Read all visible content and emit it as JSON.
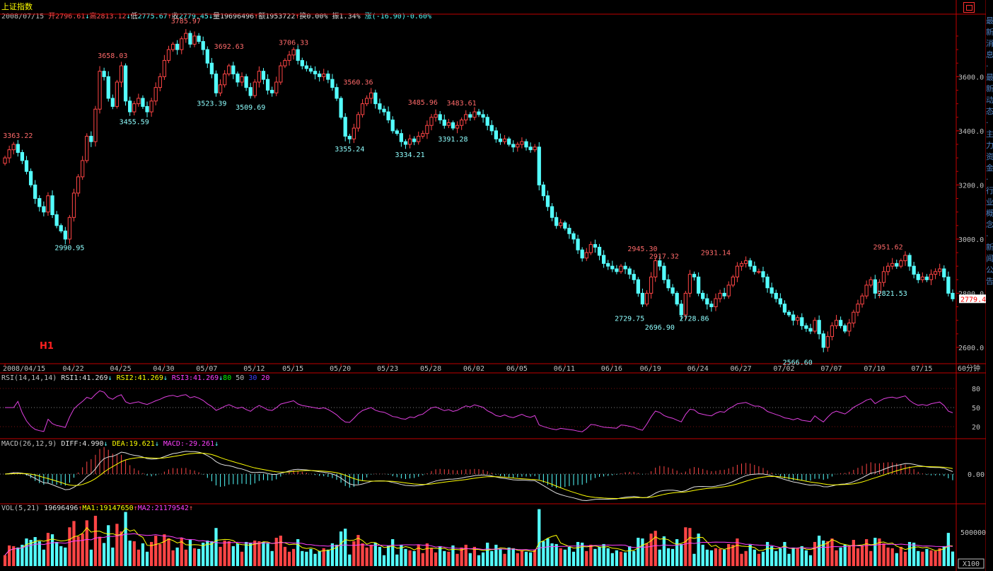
{
  "header": {
    "title": "上证指数",
    "date": "2008/07/15",
    "open_label": "开",
    "open": "2796.61",
    "open_arrow": "↓",
    "high_label": "高",
    "high": "2813.12",
    "high_arrow": "↓",
    "low_label": "低",
    "low": "2775.67",
    "low_arrow": "↑",
    "close_label": "收",
    "close": "2779.45",
    "close_arrow": "↓",
    "vol_label": "量",
    "vol": "19696496",
    "vol_arrow": "↑",
    "amt_label": "额",
    "amt": "1953722",
    "amt_arrow": "↑",
    "turn_label": "换",
    "turn": "0.00%",
    "amp_label": "振",
    "amp": "1.34%",
    "chg_label": "涨",
    "chg": "(-16.90)-0.60%"
  },
  "indicators": {
    "rsi": {
      "name": "RSI(14,14,14)",
      "rsi1": "RSI1:41.269",
      "rsi1_arrow": "↓",
      "rsi2": "RSI2:41.269",
      "rsi2_arrow": "↓",
      "rsi3": "RSI3:41.269",
      "rsi3_arrow": "↓",
      "l80": "80",
      "l50": "50",
      "l30": "30",
      "l20": "20"
    },
    "macd": {
      "name": "MACD(26,12,9)",
      "diff": "DIFF:4.990",
      "diff_arrow": "↓",
      "dea": "DEA:19.621",
      "dea_arrow": "↓",
      "macd": "MACD:-29.261",
      "macd_arrow": "↓"
    },
    "vol": {
      "name": "VOL(5,21)",
      "value": "19696496",
      "ma1": "MA1:19147650",
      "ma1_arrow": "↑",
      "ma2": "MA2:21179542",
      "ma2_arrow": "↑"
    }
  },
  "badge": "H1",
  "period_label": "60分钟",
  "x100_label": "X100",
  "current_price_tag": "2779.4",
  "side_text": "最新消息·最新动态·主力资金·行业概念·新闻公告",
  "colors": {
    "up": "#ff4545",
    "down": "#54ffff",
    "axis": "#c00000",
    "rsi": "#e040e0",
    "diff": "#e0e0e0",
    "dea": "#ffff00",
    "ma1": "#ffff00",
    "ma2": "#ff40ff"
  },
  "chart_data": [
    {
      "type": "candlestick",
      "title": "上证指数",
      "interval": "60分钟",
      "y_ticks": [
        2600,
        2800,
        3000,
        3200,
        3400,
        3600
      ],
      "y_tick_labels": [
        "2600.0",
        "2800.0",
        "3000.0",
        "3200.0",
        "3400.0",
        "3600.0"
      ],
      "ylim": [
        2545,
        3810
      ],
      "x_tick_labels": [
        "2008/04/15",
        "04/22",
        "04/25",
        "04/30",
        "05/07",
        "05/12",
        "05/15",
        "05/20",
        "05/23",
        "05/28",
        "06/02",
        "06/05",
        "06/11",
        "06/16",
        "06/19",
        "06/24",
        "06/27",
        "07/02",
        "07/07",
        "07/10",
        "07/15"
      ],
      "x_tick_index": [
        0,
        16,
        27,
        37,
        47,
        58,
        67,
        78,
        89,
        99,
        109,
        119,
        130,
        141,
        150,
        161,
        171,
        181,
        192,
        202,
        213
      ],
      "closes": [
        3300,
        3330,
        3350,
        3320,
        3290,
        3250,
        3200,
        3150,
        3120,
        3100,
        3160,
        3090,
        3050,
        3030,
        3000,
        3080,
        3170,
        3230,
        3290,
        3380,
        3360,
        3480,
        3620,
        3600,
        3520,
        3490,
        3580,
        3640,
        3510,
        3470,
        3500,
        3520,
        3490,
        3470,
        3510,
        3560,
        3600,
        3660,
        3700,
        3720,
        3700,
        3740,
        3760,
        3720,
        3750,
        3730,
        3700,
        3650,
        3610,
        3540,
        3570,
        3610,
        3640,
        3610,
        3580,
        3600,
        3560,
        3530,
        3580,
        3620,
        3590,
        3550,
        3540,
        3580,
        3640,
        3660,
        3680,
        3700,
        3660,
        3640,
        3630,
        3620,
        3610,
        3600,
        3610,
        3590,
        3560,
        3520,
        3450,
        3380,
        3370,
        3410,
        3460,
        3500,
        3520,
        3540,
        3500,
        3480,
        3470,
        3440,
        3400,
        3390,
        3360,
        3350,
        3370,
        3360,
        3380,
        3390,
        3420,
        3450,
        3460,
        3440,
        3420,
        3430,
        3410,
        3420,
        3440,
        3460,
        3450,
        3470,
        3460,
        3450,
        3420,
        3400,
        3370,
        3360,
        3370,
        3350,
        3340,
        3350,
        3360,
        3340,
        3330,
        3340,
        3200,
        3160,
        3120,
        3080,
        3050,
        3060,
        3040,
        3020,
        3000,
        2960,
        2930,
        2950,
        2980,
        2970,
        2940,
        2910,
        2900,
        2890,
        2880,
        2900,
        2890,
        2870,
        2850,
        2800,
        2760,
        2800,
        2860,
        2920,
        2900,
        2850,
        2820,
        2800,
        2760,
        2720,
        2800,
        2870,
        2860,
        2800,
        2780,
        2760,
        2750,
        2780,
        2800,
        2790,
        2830,
        2860,
        2900,
        2910,
        2920,
        2900,
        2880,
        2880,
        2860,
        2820,
        2800,
        2780,
        2760,
        2730,
        2720,
        2700,
        2710,
        2680,
        2670,
        2660,
        2700,
        2650,
        2600,
        2640,
        2680,
        2700,
        2680,
        2660,
        2690,
        2730,
        2760,
        2790,
        2830,
        2850,
        2800,
        2840,
        2880,
        2900,
        2910,
        2900,
        2920,
        2940,
        2900,
        2870,
        2850,
        2860,
        2850,
        2870,
        2880,
        2890,
        2860,
        2800,
        2779.45
      ],
      "annotations": [
        {
          "label": "3363.22",
          "i": 3,
          "kind": "high"
        },
        {
          "label": "2990.95",
          "i": 15,
          "kind": "low"
        },
        {
          "label": "3658.03",
          "i": 25,
          "kind": "high"
        },
        {
          "label": "3455.59",
          "i": 30,
          "kind": "low"
        },
        {
          "label": "3785.97",
          "i": 42,
          "kind": "high"
        },
        {
          "label": "3692.63",
          "i": 52,
          "kind": "high"
        },
        {
          "label": "3523.39",
          "i": 48,
          "kind": "low"
        },
        {
          "label": "3509.69",
          "i": 57,
          "kind": "low"
        },
        {
          "label": "3706.33",
          "i": 67,
          "kind": "high"
        },
        {
          "label": "3560.36",
          "i": 82,
          "kind": "high"
        },
        {
          "label": "3355.24",
          "i": 80,
          "kind": "low"
        },
        {
          "label": "3485.96",
          "i": 97,
          "kind": "high"
        },
        {
          "label": "3334.21",
          "i": 94,
          "kind": "low"
        },
        {
          "label": "3483.61",
          "i": 106,
          "kind": "high"
        },
        {
          "label": "3391.28",
          "i": 104,
          "kind": "low"
        },
        {
          "label": "2945.30",
          "i": 148,
          "kind": "high"
        },
        {
          "label": "2917.32",
          "i": 153,
          "kind": "high"
        },
        {
          "label": "2729.75",
          "i": 145,
          "kind": "low"
        },
        {
          "label": "2696.90",
          "i": 152,
          "kind": "low"
        },
        {
          "label": "2931.14",
          "i": 165,
          "kind": "high"
        },
        {
          "label": "2728.86",
          "i": 160,
          "kind": "low"
        },
        {
          "label": "2566.60",
          "i": 184,
          "kind": "low"
        },
        {
          "label": "2951.62",
          "i": 205,
          "kind": "high"
        },
        {
          "label": "2821.53",
          "i": 206,
          "kind": "low"
        }
      ]
    },
    {
      "type": "line",
      "title": "RSI(14,14,14)",
      "y_ticks": [
        20,
        50,
        80
      ],
      "ylim": [
        10,
        90
      ]
    },
    {
      "type": "bar+line",
      "title": "MACD(26,12,9)",
      "y_ticks": [
        "0.00"
      ]
    },
    {
      "type": "bar",
      "title": "VOL(5,21)",
      "y_ticks": [
        "500000"
      ],
      "unit": "X100"
    }
  ]
}
